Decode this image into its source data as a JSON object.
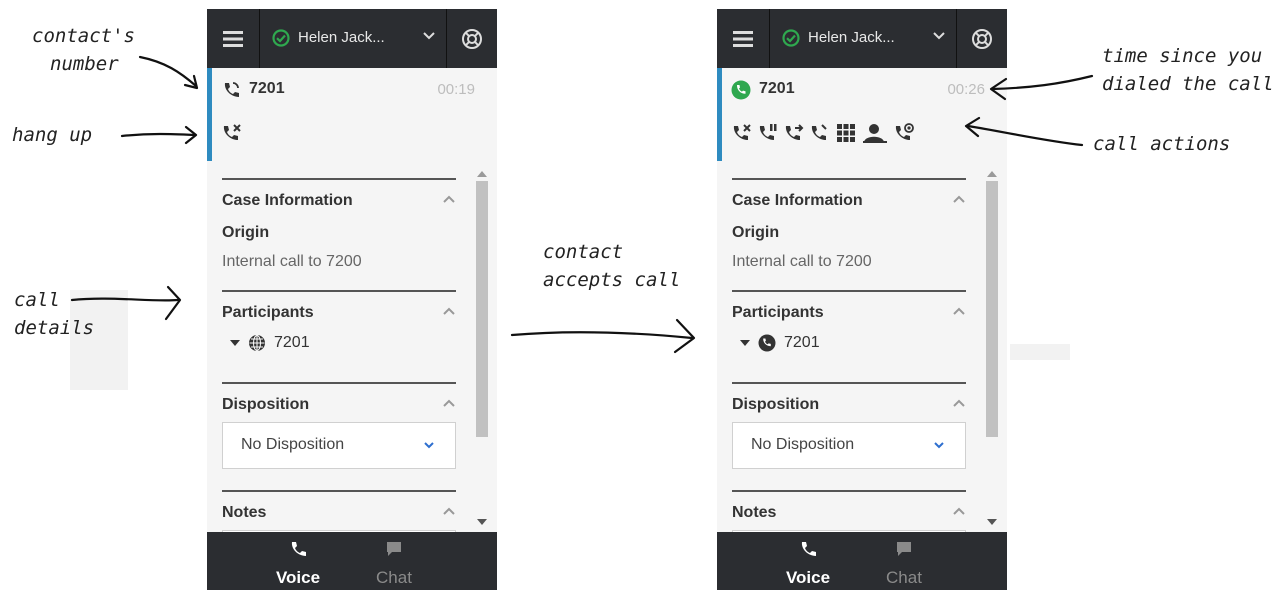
{
  "annotations": {
    "contacts_number": [
      "contact's",
      "number"
    ],
    "hang_up": "hang up",
    "call_details": [
      "call",
      "details"
    ],
    "contact_accepts": [
      "contact",
      "accepts call"
    ],
    "time_since": [
      "time since you",
      "dialed the call"
    ],
    "call_actions": "call actions"
  },
  "left_panel": {
    "agent_name": "Helen Jack...",
    "call_number": "7201",
    "call_time": "00:19",
    "case_info_title": "Case Information",
    "origin_label": "Origin",
    "origin_value": "Internal call to 7200",
    "participants_title": "Participants",
    "participant": "7201",
    "disposition_title": "Disposition",
    "disposition_value": "No Disposition",
    "notes_title": "Notes",
    "tab_voice": "Voice",
    "tab_chat": "Chat"
  },
  "right_panel": {
    "agent_name": "Helen Jack...",
    "call_number": "7201",
    "call_time": "00:26",
    "case_info_title": "Case Information",
    "origin_label": "Origin",
    "origin_value": "Internal call to 7200",
    "participants_title": "Participants",
    "participant": "7201",
    "disposition_title": "Disposition",
    "disposition_value": "No Disposition",
    "notes_title": "Notes",
    "tab_voice": "Voice",
    "tab_chat": "Chat"
  },
  "icons": {
    "menu": "hamburger-menu-icon",
    "status": "ready-status-icon",
    "support": "support-icon",
    "hang_up": "hang-up-icon",
    "hold": "hold-call-icon",
    "transfer": "transfer-call-icon",
    "conference": "conference-call-icon",
    "keypad": "keypad-icon",
    "consult": "consult-icon",
    "record": "record-call-icon",
    "chat": "chat-bubble-icon"
  },
  "colors": {
    "topbar": "#2b2d31",
    "accent": "#2e8bc0",
    "status_green": "#2fa84f",
    "link_blue": "#2e6fcf"
  }
}
